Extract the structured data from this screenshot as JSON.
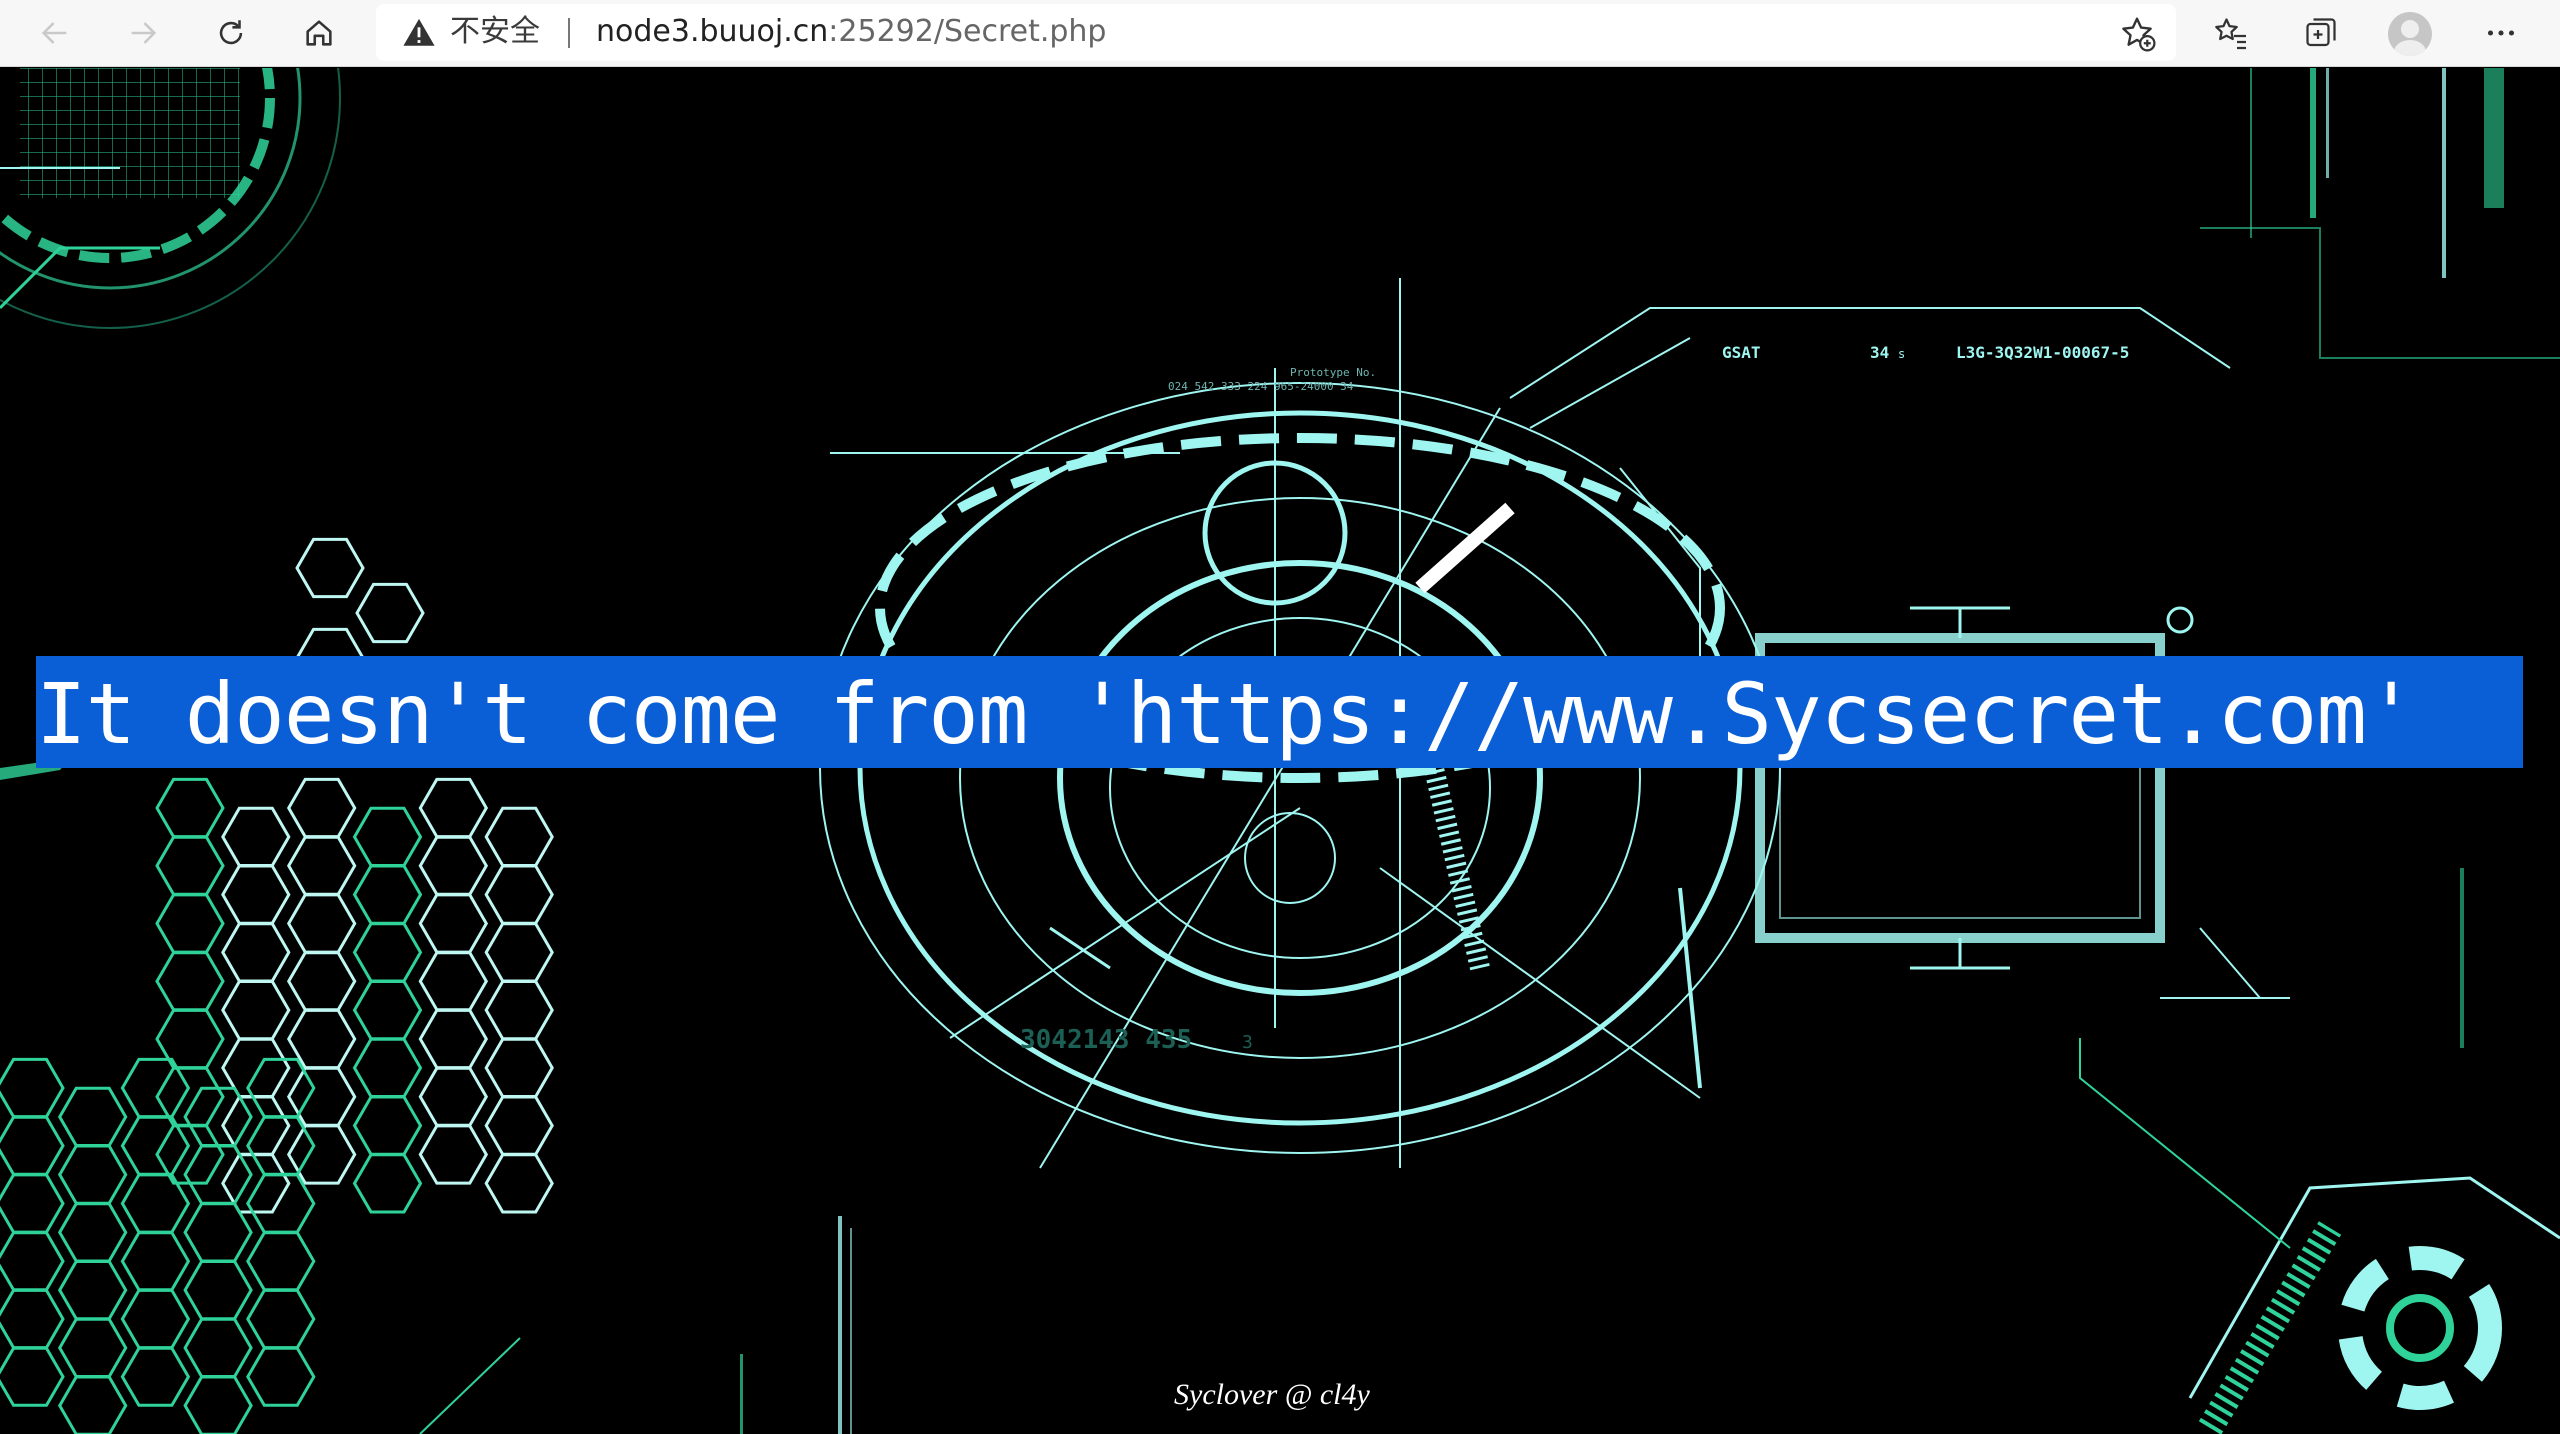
{
  "browser": {
    "security_label": "不安全",
    "url_host": "node3.buuoj.cn",
    "url_rest": ":25292/Secret.php",
    "icons": {
      "back": "arrow-left-icon",
      "forward": "arrow-right-icon",
      "reload": "refresh-icon",
      "home": "home-icon",
      "warning": "warning-triangle-icon",
      "add_favorite": "star-plus-icon",
      "favorites": "star-list-icon",
      "collections": "collections-icon",
      "profile": "avatar",
      "menu": "more-icon"
    }
  },
  "page": {
    "message": "It doesn't come from 'https://www.Sycsecret.com'",
    "footer": "Syclover @ cl4y",
    "hud_labels": {
      "gsat": "GSAT",
      "count": "34",
      "count_unit": "s",
      "code": "L3G-3Q32W1-00067-5",
      "prototype": "Prototype No.",
      "serial": "024 542 333 224 965-24000 34",
      "lower_code": "3042143 435",
      "lower_code_suffix": "3"
    }
  },
  "colors": {
    "banner": "#0a5fd6",
    "hud_primary": "#9ff5f0",
    "hud_green": "#2fd39a",
    "background": "#000000"
  }
}
